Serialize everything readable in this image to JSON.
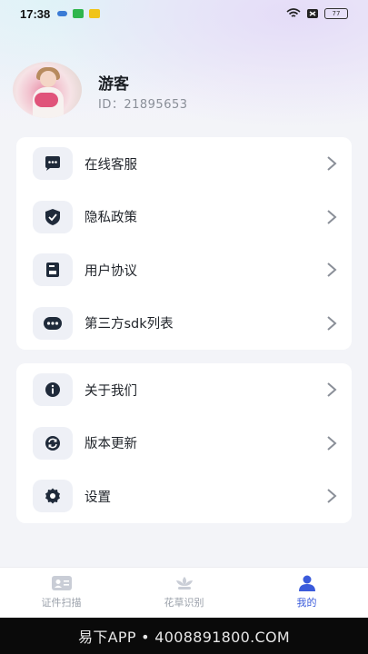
{
  "status_bar": {
    "time": "17:38",
    "battery": "77"
  },
  "profile": {
    "name": "游客",
    "id_text": "ID：21895653"
  },
  "menu_group_1": [
    {
      "label": "在线客服",
      "icon": "chat-icon"
    },
    {
      "label": "隐私政策",
      "icon": "shield-icon"
    },
    {
      "label": "用户协议",
      "icon": "document-icon"
    },
    {
      "label": "第三方sdk列表",
      "icon": "more-dots-icon"
    }
  ],
  "menu_group_2": [
    {
      "label": "关于我们",
      "icon": "info-icon"
    },
    {
      "label": "版本更新",
      "icon": "refresh-icon"
    },
    {
      "label": "设置",
      "icon": "gear-icon"
    }
  ],
  "tabbar": [
    {
      "label": "证件扫描",
      "icon": "id-card-icon",
      "active": false
    },
    {
      "label": "花草识别",
      "icon": "flower-icon",
      "active": false
    },
    {
      "label": "我的",
      "icon": "user-icon",
      "active": true
    }
  ],
  "watermark": "易下APP • 4008891800.COM",
  "colors": {
    "accent": "#3b5bdb",
    "icon_dark": "#1f2a3a",
    "icon_bg": "#eef0f6",
    "page_bg": "#f3f4f8"
  }
}
